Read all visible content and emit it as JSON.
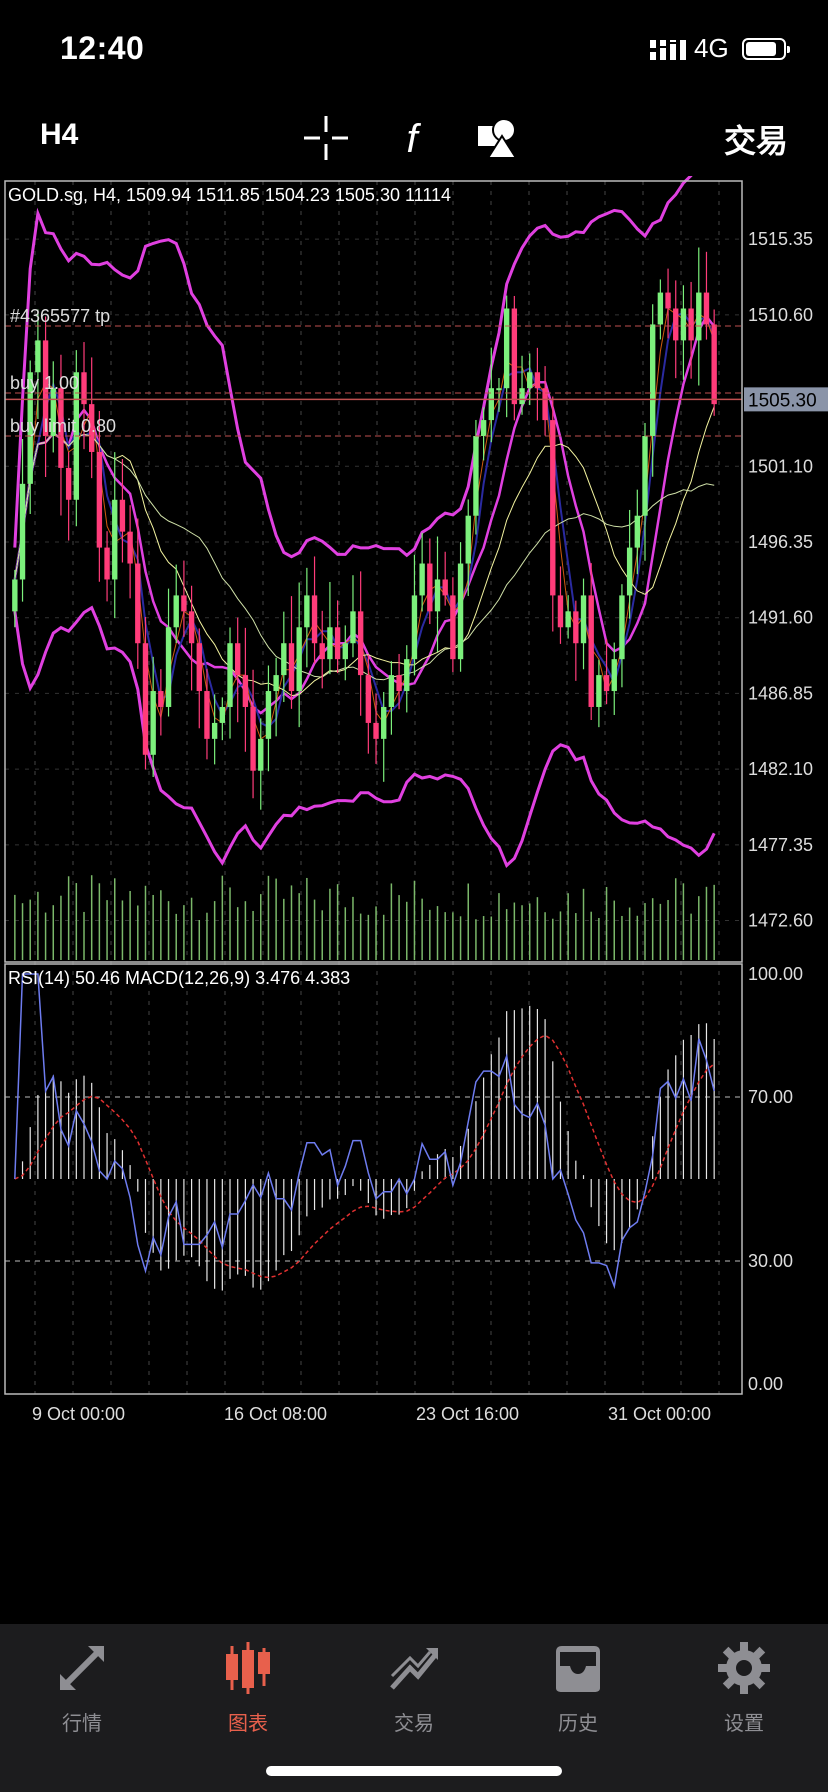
{
  "status_bar": {
    "time": "12:40",
    "network": "4G"
  },
  "toolbar": {
    "timeframe": "H4",
    "icons": [
      "crosshair-icon",
      "indicator-f-icon",
      "objects-shapes-icon"
    ],
    "trade_label": "交易"
  },
  "chart": {
    "header": "GOLD.sg, H4, 1509.94 1511.85 1504.23 1505.30 11114",
    "price_axis": [
      "1515.35",
      "1510.60",
      "1501.10",
      "1496.35",
      "1491.60",
      "1486.85",
      "1482.10",
      "1477.35",
      "1472.60"
    ],
    "current_price": "1505.30",
    "order_lines": [
      {
        "label": "#4365577 tp",
        "price": 1509.9
      },
      {
        "label": "buy 1.00",
        "price": 1505.7
      },
      {
        "label": "buy limit 0.80",
        "price": 1503.0
      }
    ],
    "lower_header": "RSI(14) 50.46 MACD(12,26,9) 3.476 4.383",
    "lower_axis": [
      "100.00",
      "70.00",
      "30.00",
      "0.00"
    ],
    "time_axis": [
      "9 Oct 00:00",
      "16 Oct 08:00",
      "23 Oct 16:00",
      "31 Oct 00:00"
    ],
    "colors": {
      "bull": "#7CF07C",
      "bear": "#FF3C7A",
      "bands": "#E040E0",
      "rsi": "#6E7CF0",
      "signal": "#E03030",
      "price_box": "#8A94A8"
    }
  },
  "chart_data": {
    "type": "candlestick",
    "symbol": "GOLD.sg",
    "timeframe": "H4",
    "ohlc_last": {
      "open": 1509.94,
      "high": 1511.85,
      "low": 1504.23,
      "close": 1505.3,
      "volume": 11114
    },
    "y_axis": {
      "min": 1470,
      "max": 1519
    },
    "closes": [
      1494,
      1500,
      1507,
      1509,
      1503,
      1506,
      1501,
      1499,
      1507,
      1505,
      1502,
      1496,
      1494,
      1499,
      1497,
      1495,
      1490,
      1483,
      1487,
      1486,
      1491,
      1493,
      1492,
      1490,
      1487,
      1484,
      1485,
      1486,
      1490,
      1488,
      1486,
      1482,
      1484,
      1487,
      1488,
      1490,
      1487,
      1491,
      1493,
      1490,
      1489,
      1491,
      1489,
      1490,
      1492,
      1488,
      1485,
      1484,
      1486,
      1488,
      1487,
      1489,
      1493,
      1495,
      1492,
      1494,
      1493,
      1489,
      1495,
      1498,
      1503,
      1504,
      1506,
      1506,
      1511,
      1505,
      1506,
      1507,
      1506,
      1504,
      1493,
      1491,
      1492,
      1490,
      1493,
      1486,
      1488,
      1487,
      1489,
      1493,
      1496,
      1498,
      1503,
      1510,
      1512,
      1511,
      1509,
      1511,
      1509,
      1512,
      1510,
      1505
    ],
    "rsi": {
      "value": 50.46,
      "levels": [
        30,
        70
      ],
      "range": [
        0,
        100
      ]
    },
    "macd": {
      "params": "12,26,9",
      "main": 3.476,
      "signal": 4.383
    },
    "time_labels": [
      "9 Oct 00:00",
      "16 Oct 08:00",
      "23 Oct 16:00",
      "31 Oct 00:00"
    ]
  },
  "tabbar": {
    "items": [
      {
        "label": "行情",
        "icon": "quotes-arrows-icon",
        "active": false
      },
      {
        "label": "图表",
        "icon": "chart-candles-icon",
        "active": true
      },
      {
        "label": "交易",
        "icon": "trade-chart-icon",
        "active": false
      },
      {
        "label": "历史",
        "icon": "history-inbox-icon",
        "active": false
      },
      {
        "label": "设置",
        "icon": "settings-gear-icon",
        "active": false
      }
    ]
  }
}
